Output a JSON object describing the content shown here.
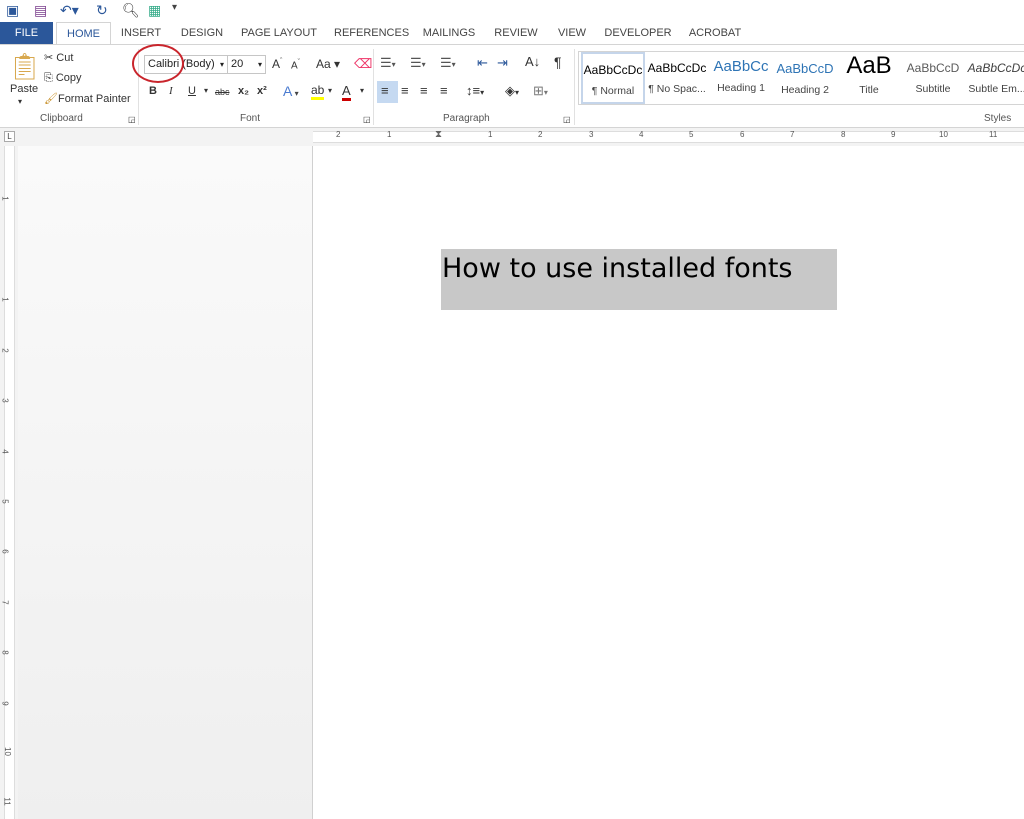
{
  "quick_access": {
    "icons": [
      "word-icon",
      "save-icon",
      "undo-icon",
      "redo-icon",
      "print-preview-icon",
      "touch-mode-icon",
      "customize-icon"
    ]
  },
  "tabs": [
    "FILE",
    "HOME",
    "INSERT",
    "DESIGN",
    "PAGE LAYOUT",
    "REFERENCES",
    "MAILINGS",
    "REVIEW",
    "VIEW",
    "DEVELOPER",
    "ACROBAT"
  ],
  "active_tab": "HOME",
  "clipboard": {
    "paste": "Paste",
    "cut": "Cut",
    "copy": "Copy",
    "format_painter": "Format Painter",
    "label": "Clipboard"
  },
  "font": {
    "name": "Calibri (Body)",
    "size": "20",
    "change_case": "Aa",
    "label": "Font",
    "bold": "B",
    "italic": "I",
    "underline": "U",
    "strike": "abc",
    "subscript": "x₂",
    "superscript": "x²"
  },
  "paragraph": {
    "label": "Paragraph",
    "pilcrow": "¶"
  },
  "styles": {
    "label": "Styles",
    "items": [
      {
        "preview": "AaBbCcDc",
        "name": "¶ Normal",
        "selected": true
      },
      {
        "preview": "AaBbCcDc",
        "name": "¶ No Spac..."
      },
      {
        "preview": "AaBbCc",
        "name": "Heading 1",
        "color": "#2e74b5"
      },
      {
        "preview": "AaBbCcD",
        "name": "Heading 2",
        "color": "#2e74b5"
      },
      {
        "preview": "AaB",
        "name": "Title"
      },
      {
        "preview": "AaBbCcD",
        "name": "Subtitle",
        "color": "#5a5a5a"
      },
      {
        "preview": "AaBbCcDc",
        "name": "Subtle Em..."
      }
    ]
  },
  "ruler": {
    "horizontal": [
      "2",
      "1",
      "1",
      "2",
      "3",
      "4",
      "5",
      "6",
      "7",
      "8",
      "9",
      "10",
      "11"
    ],
    "vertical": [
      "1",
      "1",
      "2",
      "3",
      "4",
      "5",
      "6",
      "7",
      "8",
      "9",
      "10",
      "11"
    ]
  },
  "document": {
    "text": "How to use installed fonts"
  },
  "colors": {
    "file_tab": "#2b579a",
    "annotation_circle": "#c9252c",
    "selection": "#c8c8c8"
  }
}
